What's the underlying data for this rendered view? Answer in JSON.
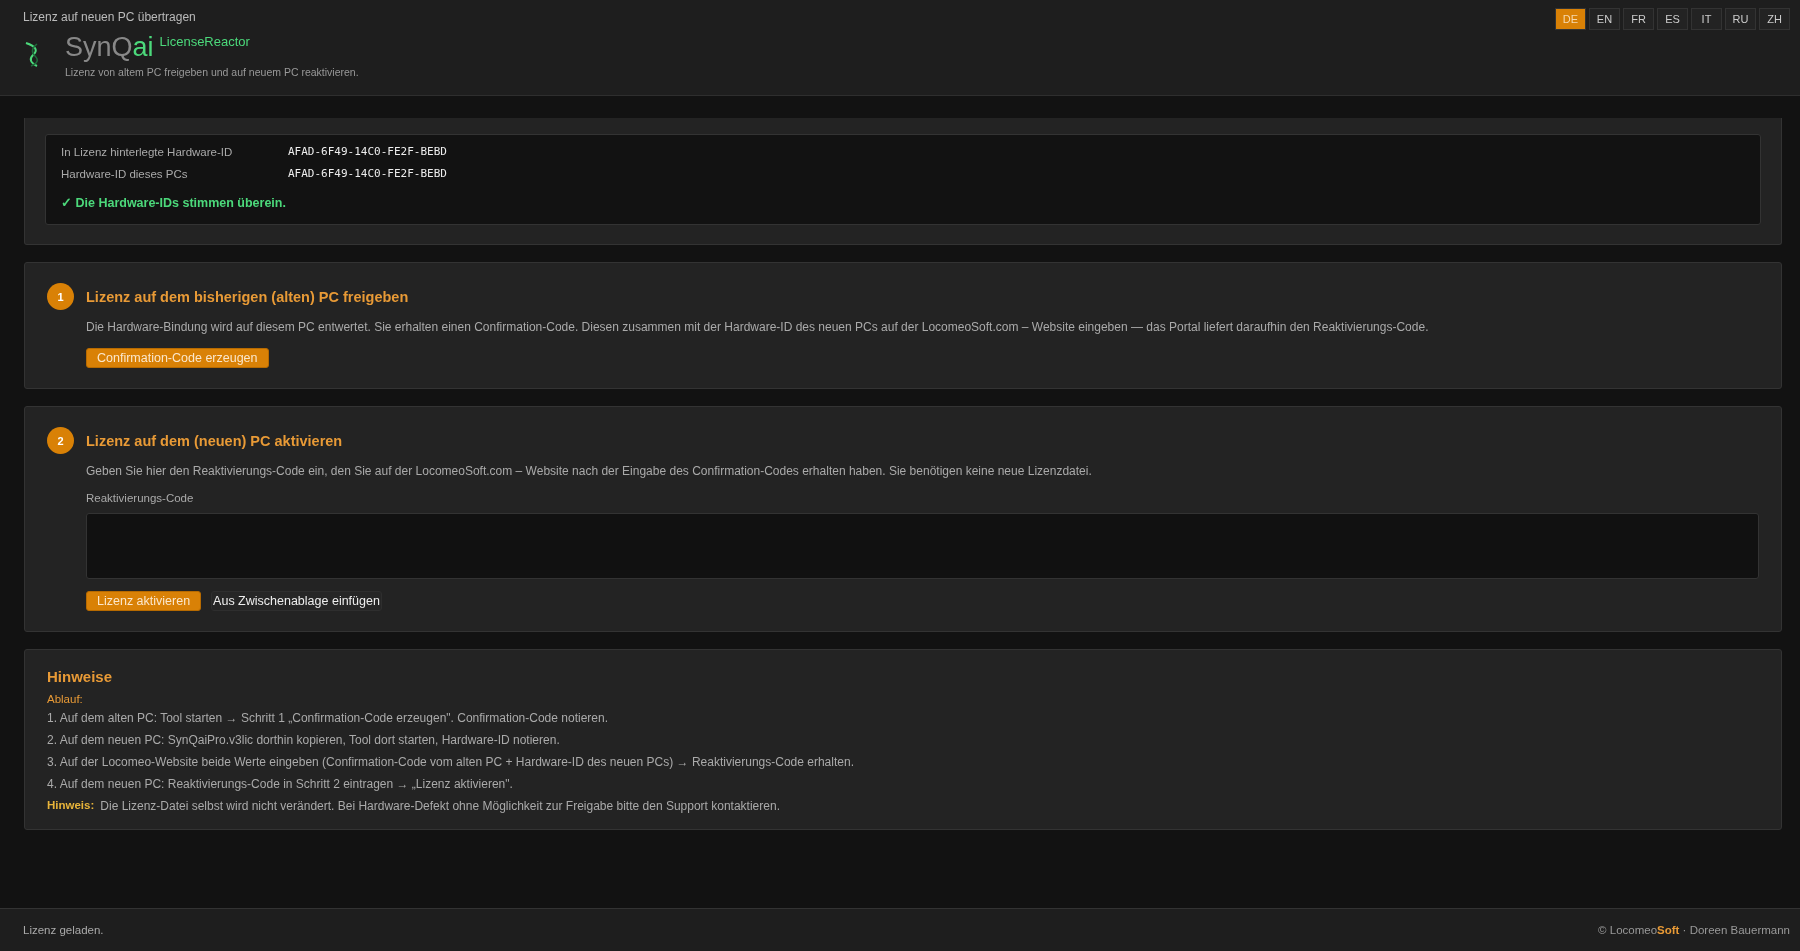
{
  "window": {
    "title": "Lizenz auf neuen PC übertragen"
  },
  "brand": {
    "name_main": "SynQ",
    "name_accent": "ai",
    "product": "LicenseReactor",
    "subtitle": "Lizenz von altem PC freigeben und auf neuem PC reaktivieren."
  },
  "languages": [
    {
      "label": "DE",
      "selected": true
    },
    {
      "label": "EN",
      "selected": false
    },
    {
      "label": "FR",
      "selected": false
    },
    {
      "label": "ES",
      "selected": false
    },
    {
      "label": "IT",
      "selected": false
    },
    {
      "label": "RU",
      "selected": false
    },
    {
      "label": "ZH",
      "selected": false
    }
  ],
  "hardware": {
    "rows": [
      {
        "label": "In Lizenz hinterlegte Hardware-ID",
        "value": "AFAD-6F49-14C0-FE2F-BEBD"
      },
      {
        "label": "Hardware-ID dieses PCs",
        "value": "AFAD-6F49-14C0-FE2F-BEBD"
      }
    ],
    "match": true,
    "status": "✓ Die Hardware-IDs stimmen überein."
  },
  "steps": [
    {
      "number": "1",
      "title": "Lizenz auf dem bisherigen (alten) PC freigeben",
      "text": "Die Hardware-Bindung wird auf diesem PC entwertet. Sie erhalten einen Confirmation-Code. Diesen zusammen mit der Hardware-ID des neuen PCs auf der LocomeoSoft.com – Website eingeben — das Portal liefert daraufhin den Reaktivierungs-Code.",
      "buttons": [
        {
          "label": "Confirmation-Code erzeugen",
          "kind": "primary"
        }
      ]
    },
    {
      "number": "2",
      "title": "Lizenz auf dem (neuen) PC aktivieren",
      "text": "Geben Sie hier den Reaktivierungs-Code ein, den Sie auf der LocomeoSoft.com – Website nach der Eingabe des Confirmation-Codes erhalten haben. Sie benötigen keine neue Lizenzdatei.",
      "field_label": "Reaktivierungs-Code",
      "buttons": [
        {
          "label": "Lizenz aktivieren",
          "kind": "primary"
        },
        {
          "label": "Aus Zwischenablage einfügen",
          "kind": "secondary"
        }
      ]
    }
  ],
  "hints": {
    "title": "Hinweise",
    "subtitle": "Ablauf:",
    "items": [
      "1. Auf dem alten PC: Tool starten → Schritt 1 „Confirmation-Code erzeugen\". Confirmation-Code notieren.",
      "2. Auf dem neuen PC: SynQaiPro.v3lic dorthin kopieren, Tool dort starten, Hardware-ID notieren.",
      "3. Auf der Locomeo-Website beide Werte eingeben (Confirmation-Code vom alten PC + Hardware-ID des neuen PCs) → Reaktivierungs-Code erhalten.",
      "4. Auf dem neuen PC: Reaktivierungs-Code in Schritt 2 eintragen → „Lizenz aktivieren\"."
    ],
    "note_label": "Hinweis:",
    "note": "Die Lizenz-Datei selbst wird nicht verändert. Bei Hardware-Defekt ohne Möglichkeit zur Freigabe bitte den Support kontaktieren."
  },
  "status_bar": {
    "message": "Lizenz geladen.",
    "copyright_prefix": "© Locomeo",
    "copyright_accent": "Soft",
    "copyright_suffix": " · Doreen Bauermann"
  }
}
